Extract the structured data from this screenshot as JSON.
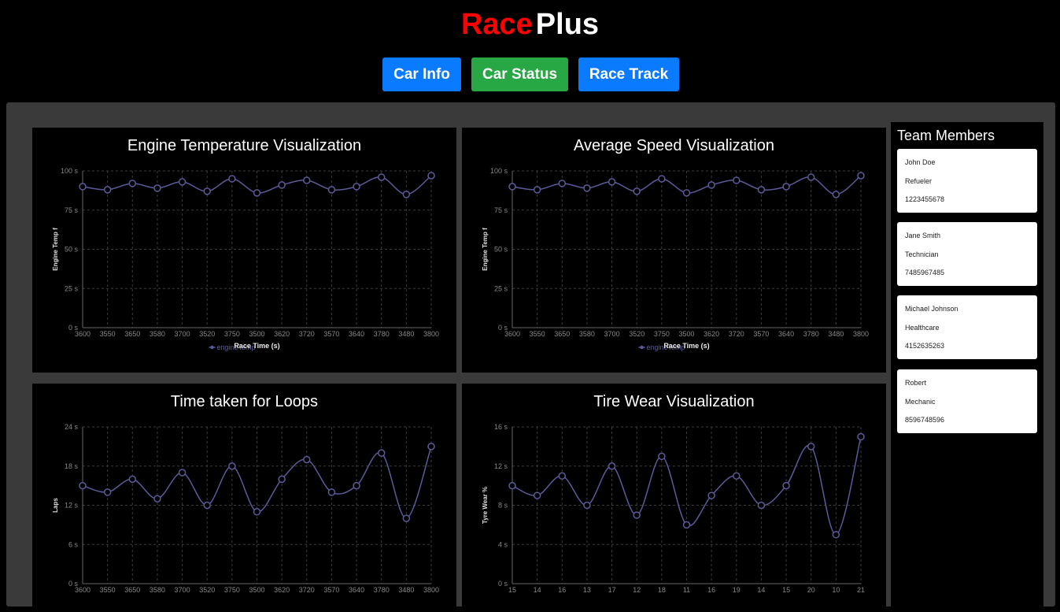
{
  "brand": {
    "part1": "Race",
    "part2": "Plus"
  },
  "nav": {
    "car_info": "Car Info",
    "car_status": "Car Status",
    "race_track": "Race Track"
  },
  "colors": {
    "brand_red": "#ff0000",
    "nav_blue": "#0a7bff",
    "nav_green": "#28a745",
    "panel_gray": "#3a3a3a",
    "series_line": "#5b5b99"
  },
  "charts": [
    {
      "title": "Engine Temperature Visualization",
      "chart_data": {
        "type": "line",
        "categories": [
          "3600",
          "3550",
          "3650",
          "3580",
          "3700",
          "3520",
          "3750",
          "3500",
          "3620",
          "3720",
          "3570",
          "3640",
          "3780",
          "3480",
          "3800"
        ],
        "series": [
          {
            "name": "engineTemp",
            "values": [
              90,
              88,
              92,
              89,
              93,
              87,
              95,
              86,
              91,
              94,
              88,
              90,
              96,
              85,
              97
            ]
          }
        ],
        "xlabel": "Race Time (s)",
        "ylabel": "Engine Temp f",
        "ylim": [
          0,
          100
        ],
        "yticks": [
          "0 s",
          "25 s",
          "50 s",
          "75 s",
          "100 s"
        ],
        "grid": true,
        "legend": "bottom"
      }
    },
    {
      "title": "Average Speed Visualization",
      "chart_data": {
        "type": "line",
        "categories": [
          "3600",
          "3550",
          "3650",
          "3580",
          "3700",
          "3520",
          "3750",
          "3500",
          "3620",
          "3720",
          "3570",
          "3640",
          "3780",
          "3480",
          "3800"
        ],
        "series": [
          {
            "name": "engineTemp",
            "values": [
              90,
              88,
              92,
              89,
              93,
              87,
              95,
              86,
              91,
              94,
              88,
              90,
              96,
              85,
              97
            ]
          }
        ],
        "xlabel": "Race Time (s)",
        "ylabel": "Engine Temp f",
        "ylim": [
          0,
          100
        ],
        "yticks": [
          "0 s",
          "25 s",
          "50 s",
          "75 s",
          "100 s"
        ],
        "grid": true,
        "legend": "bottom"
      }
    },
    {
      "title": "Time taken for Loops",
      "chart_data": {
        "type": "line",
        "categories": [
          "3600",
          "3550",
          "3650",
          "3580",
          "3700",
          "3520",
          "3750",
          "3500",
          "3620",
          "3720",
          "3570",
          "3640",
          "3780",
          "3480",
          "3800"
        ],
        "series": [
          {
            "values": [
              15,
              14,
              16,
              13,
              17,
              12,
              18,
              11,
              16,
              19,
              14,
              15,
              20,
              10,
              21
            ]
          }
        ],
        "xlabel": "",
        "ylabel": "Laps",
        "ylim": [
          0,
          24
        ],
        "yticks": [
          "0 s",
          "6 s",
          "12 s",
          "18 s",
          "24 s"
        ],
        "grid": true
      }
    },
    {
      "title": "Tire Wear Visualization",
      "chart_data": {
        "type": "line",
        "categories": [
          "15",
          "14",
          "16",
          "13",
          "17",
          "12",
          "18",
          "11",
          "16",
          "19",
          "14",
          "15",
          "20",
          "10",
          "21"
        ],
        "series": [
          {
            "values": [
              10,
              9,
              11,
              8,
              12,
              7,
              13,
              6,
              9,
              11,
              8,
              10,
              14,
              5,
              15
            ]
          }
        ],
        "xlabel": "",
        "ylabel": "Tyre Wear %",
        "ylim": [
          0,
          16
        ],
        "yticks": [
          "0 s",
          "4 s",
          "8 s",
          "12 s",
          "16 s"
        ],
        "grid": true
      }
    }
  ],
  "team": {
    "heading": "Team Members",
    "members": [
      {
        "name": "John Doe",
        "role": "Refueler",
        "phone": "1223455678"
      },
      {
        "name": "Jane Smith",
        "role": "Technician",
        "phone": "7485967485"
      },
      {
        "name": "Michael Johnson",
        "role": "Healthcare",
        "phone": "4152635263"
      },
      {
        "name": "Robert",
        "role": "Mechanic",
        "phone": "8596748596"
      }
    ]
  }
}
